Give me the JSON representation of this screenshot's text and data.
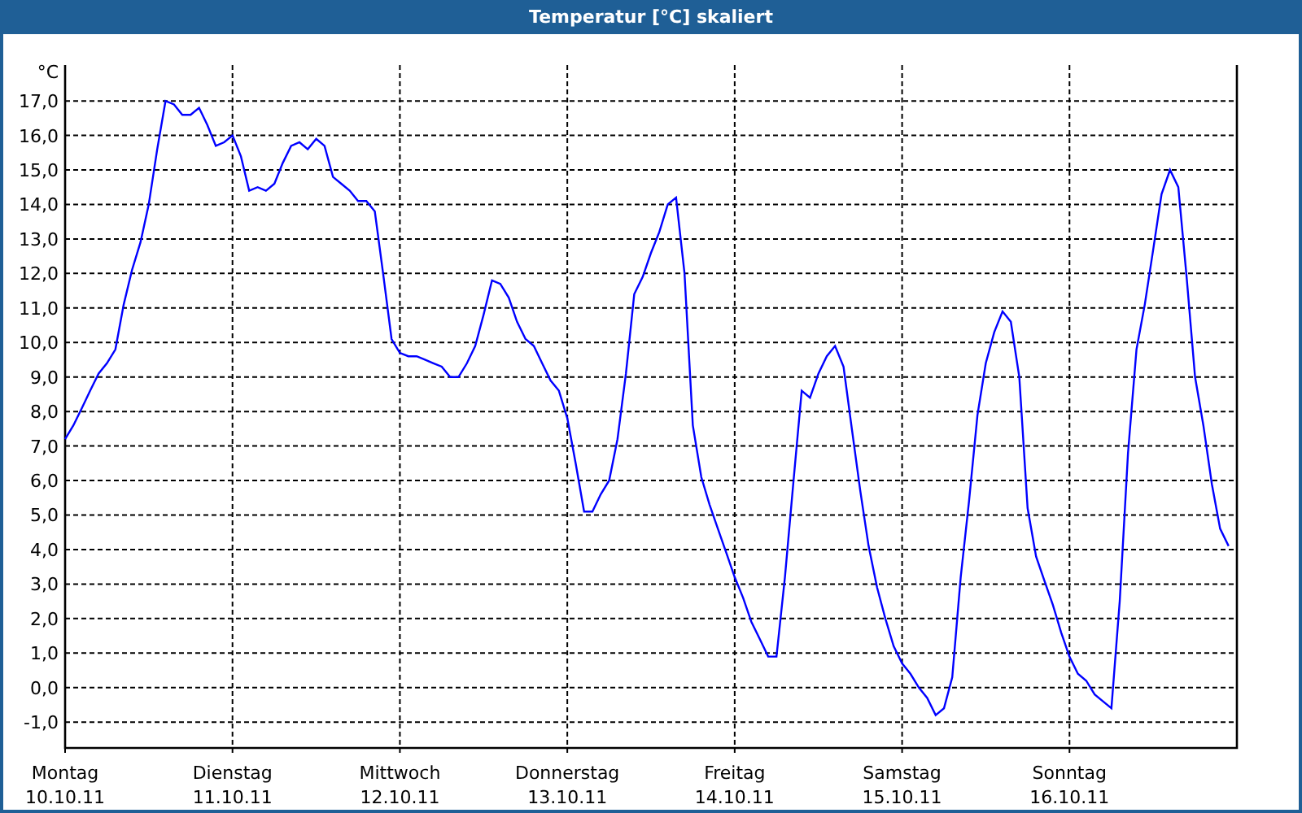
{
  "window": {
    "title": "Temperatur [°C] skaliert"
  },
  "chart": {
    "chart_data": {
      "type": "line",
      "grid": true,
      "ylabel": "°C",
      "ylim": [
        -1.75,
        18.04
      ],
      "yticks": [
        {
          "value": 17,
          "label": "17,0"
        },
        {
          "value": 16,
          "label": "16,0"
        },
        {
          "value": 15,
          "label": "15,0"
        },
        {
          "value": 14,
          "label": "14,0"
        },
        {
          "value": 13,
          "label": "13,0"
        },
        {
          "value": 12,
          "label": "12,0"
        },
        {
          "value": 11,
          "label": "11,0"
        },
        {
          "value": 10,
          "label": "10,0"
        },
        {
          "value": 9,
          "label": "9,0"
        },
        {
          "value": 8,
          "label": "8,0"
        },
        {
          "value": 7,
          "label": "7,0"
        },
        {
          "value": 6,
          "label": "6,0"
        },
        {
          "value": 5,
          "label": "5,0"
        },
        {
          "value": 4,
          "label": "4,0"
        },
        {
          "value": 3,
          "label": "3,0"
        },
        {
          "value": 2,
          "label": "2,0"
        },
        {
          "value": 1,
          "label": "1,0"
        },
        {
          "value": 0,
          "label": "0,0"
        },
        {
          "value": -1,
          "label": "-1,0"
        }
      ],
      "categories": [
        "10.10.11",
        null,
        null,
        null,
        null,
        null,
        null,
        null,
        null,
        null,
        null,
        null,
        null,
        null,
        null,
        null,
        null,
        null,
        null,
        null,
        "11.10.11",
        null,
        null,
        null,
        null,
        null,
        null,
        null,
        null,
        null,
        null,
        null,
        null,
        null,
        null,
        null,
        null,
        null,
        null,
        null,
        "12.10.11",
        null,
        null,
        null,
        null,
        null,
        null,
        null,
        null,
        null,
        null,
        null,
        null,
        null,
        null,
        null,
        null,
        null,
        null,
        null,
        "13.10.11",
        null,
        null,
        null,
        null,
        null,
        null,
        null,
        null,
        null,
        null,
        null,
        null,
        null,
        null,
        null,
        null,
        null,
        null,
        null,
        "14.10.11",
        null,
        null,
        null,
        null,
        null,
        null,
        null,
        null,
        null,
        null,
        null,
        null,
        null,
        null,
        null,
        null,
        null,
        null,
        null,
        "15.10.11",
        null,
        null,
        null,
        null,
        null,
        null,
        null,
        null,
        null,
        null,
        null,
        null,
        null,
        null,
        null,
        null,
        null,
        null,
        null,
        "16.10.11",
        null,
        null,
        null,
        null,
        null,
        null,
        null,
        null,
        null,
        null,
        null,
        null,
        null,
        null,
        null,
        null,
        null,
        null,
        null
      ],
      "series": [
        {
          "color": "#0000ff",
          "values": [
            7.2,
            7.6,
            8.1,
            8.6,
            9.1,
            9.4,
            9.8,
            11.1,
            12.1,
            12.9,
            14.0,
            15.6,
            17.0,
            16.9,
            16.6,
            16.6,
            16.8,
            16.3,
            15.7,
            15.8,
            16.0,
            15.4,
            14.4,
            14.5,
            14.4,
            14.6,
            15.2,
            15.7,
            15.8,
            15.6,
            15.9,
            15.7,
            14.8,
            14.6,
            14.4,
            14.1,
            14.1,
            13.8,
            12.0,
            10.1,
            9.7,
            9.6,
            9.6,
            9.5,
            9.4,
            9.3,
            9.0,
            9.0,
            9.4,
            9.9,
            10.8,
            11.8,
            11.7,
            11.3,
            10.6,
            10.1,
            9.9,
            9.4,
            8.9,
            8.6,
            7.8,
            6.5,
            5.1,
            5.1,
            5.6,
            6.0,
            7.2,
            9.1,
            11.4,
            11.9,
            12.6,
            13.2,
            14.0,
            14.2,
            12.0,
            7.6,
            6.1,
            5.3,
            4.6,
            3.9,
            3.2,
            2.6,
            1.9,
            1.4,
            0.9,
            0.9,
            3.2,
            5.9,
            8.6,
            8.4,
            9.1,
            9.6,
            9.9,
            9.3,
            7.5,
            5.7,
            4.1,
            2.9,
            2.0,
            1.2,
            0.7,
            0.4,
            0.0,
            -0.3,
            -0.8,
            -0.6,
            0.3,
            3.2,
            5.4,
            7.9,
            9.4,
            10.3,
            10.9,
            10.6,
            9.0,
            5.2,
            3.8,
            3.1,
            2.4,
            1.6,
            0.9,
            0.4,
            0.2,
            -0.2,
            -0.4,
            -0.6,
            2.5,
            6.8,
            9.8,
            11.1,
            12.7,
            14.3,
            15.0,
            14.5,
            11.9,
            9.0,
            7.6,
            5.9,
            4.6,
            4.1
          ]
        }
      ]
    },
    "weekday_labels": [
      "Montag",
      "Dienstag",
      "Mittwoch",
      "Donnerstag",
      "Freitag",
      "Samstag",
      "Sonntag"
    ]
  }
}
